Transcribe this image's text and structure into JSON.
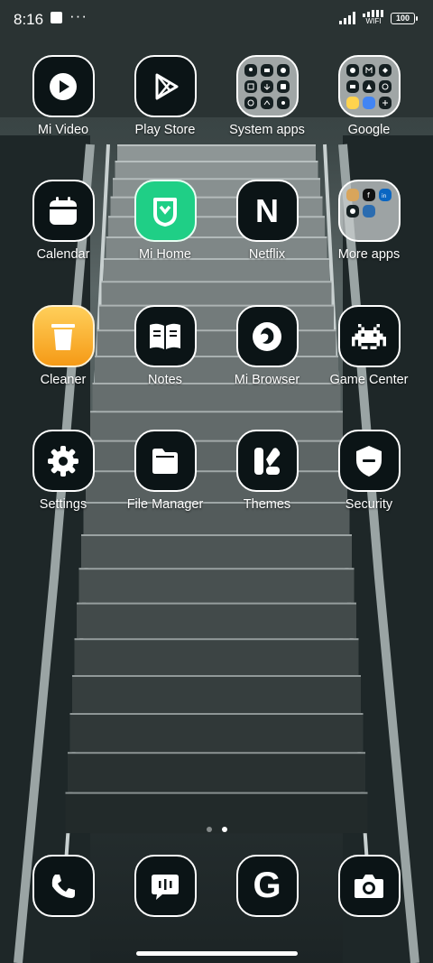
{
  "status_bar": {
    "time": "8:16",
    "overflow_dots": "···",
    "wifi_label": "WIFI",
    "battery": "100"
  },
  "apps": {
    "row1": [
      {
        "label": "Mi Video",
        "icon": "play-icon"
      },
      {
        "label": "Play Store",
        "icon": "play-store-icon"
      },
      {
        "label": "System apps",
        "icon": "folder-icon"
      },
      {
        "label": "Google",
        "icon": "folder-icon"
      }
    ],
    "row2": [
      {
        "label": "Calendar",
        "icon": "calendar-icon"
      },
      {
        "label": "Mi Home",
        "icon": "mi-home-icon"
      },
      {
        "label": "Netflix",
        "icon": "netflix-icon",
        "glyph": "N"
      },
      {
        "label": "More apps",
        "icon": "folder-icon"
      }
    ],
    "row3": [
      {
        "label": "Cleaner",
        "icon": "trash-icon"
      },
      {
        "label": "Notes",
        "icon": "book-icon"
      },
      {
        "label": "Mi Browser",
        "icon": "browser-icon"
      },
      {
        "label": "Game Center",
        "icon": "space-invader-icon"
      }
    ],
    "row4": [
      {
        "label": "Settings",
        "icon": "gear-icon"
      },
      {
        "label": "File Manager",
        "icon": "file-icon"
      },
      {
        "label": "Themes",
        "icon": "themes-icon"
      },
      {
        "label": "Security",
        "icon": "shield-icon"
      }
    ]
  },
  "dock": [
    {
      "icon": "phone-icon"
    },
    {
      "icon": "messages-icon"
    },
    {
      "icon": "google-icon",
      "glyph": "G"
    },
    {
      "icon": "camera-icon"
    }
  ],
  "page_indicator": {
    "pages": 2,
    "current": 2
  },
  "colors": {
    "icon_bg": "#0b1416",
    "mi_home_green": "#1fcf86",
    "cleaner_orange": "#f5a623"
  }
}
